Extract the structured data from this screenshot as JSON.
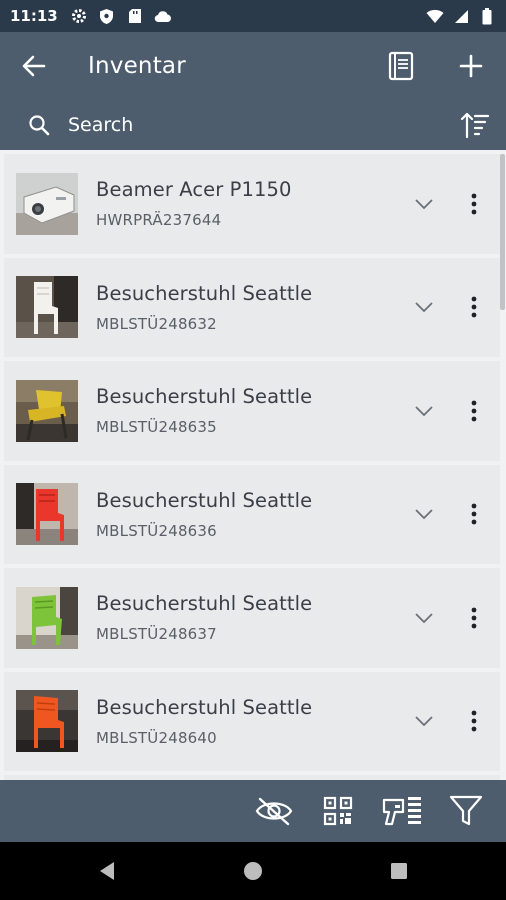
{
  "status_bar": {
    "time": "11:13",
    "left_icons": [
      "settings-icon",
      "shield-icon",
      "sd-card-icon",
      "cloud-icon"
    ],
    "right_icons": [
      "wifi-icon",
      "signal-icon",
      "battery-icon"
    ]
  },
  "app_bar": {
    "title": "Inventar",
    "back_icon": "arrow-left-icon",
    "actions": [
      "book-icon",
      "plus-icon"
    ]
  },
  "search": {
    "placeholder": "Search",
    "sort_icon": "sort-icon"
  },
  "items": [
    {
      "title": "Beamer Acer P1150",
      "code": "HWRPRÄ237644",
      "thumb": "projector"
    },
    {
      "title": "Besucherstuhl Seattle",
      "code": "MBLSTÜ248632",
      "thumb": "chair-white"
    },
    {
      "title": "Besucherstuhl Seattle",
      "code": "MBLSTÜ248635",
      "thumb": "chair-yellow"
    },
    {
      "title": "Besucherstuhl Seattle",
      "code": "MBLSTÜ248636",
      "thumb": "chair-red"
    },
    {
      "title": "Besucherstuhl Seattle",
      "code": "MBLSTÜ248637",
      "thumb": "chair-green"
    },
    {
      "title": "Besucherstuhl Seattle",
      "code": "MBLSTÜ248640",
      "thumb": "chair-orange"
    }
  ],
  "bottom_toolbar": [
    "eye-off-icon",
    "qr-code-icon",
    "barcode-scanner-icon",
    "filter-icon"
  ],
  "nav_bar": [
    "back-triangle-icon",
    "home-circle-icon",
    "recents-square-icon"
  ],
  "colors": {
    "status_bar": "#2b3a4b",
    "app_bar": "#4e5d6e",
    "list_background": "#f1f2f4",
    "card": "#e9eaec",
    "title_text": "#3a3f47",
    "sub_text": "#5a6068"
  }
}
